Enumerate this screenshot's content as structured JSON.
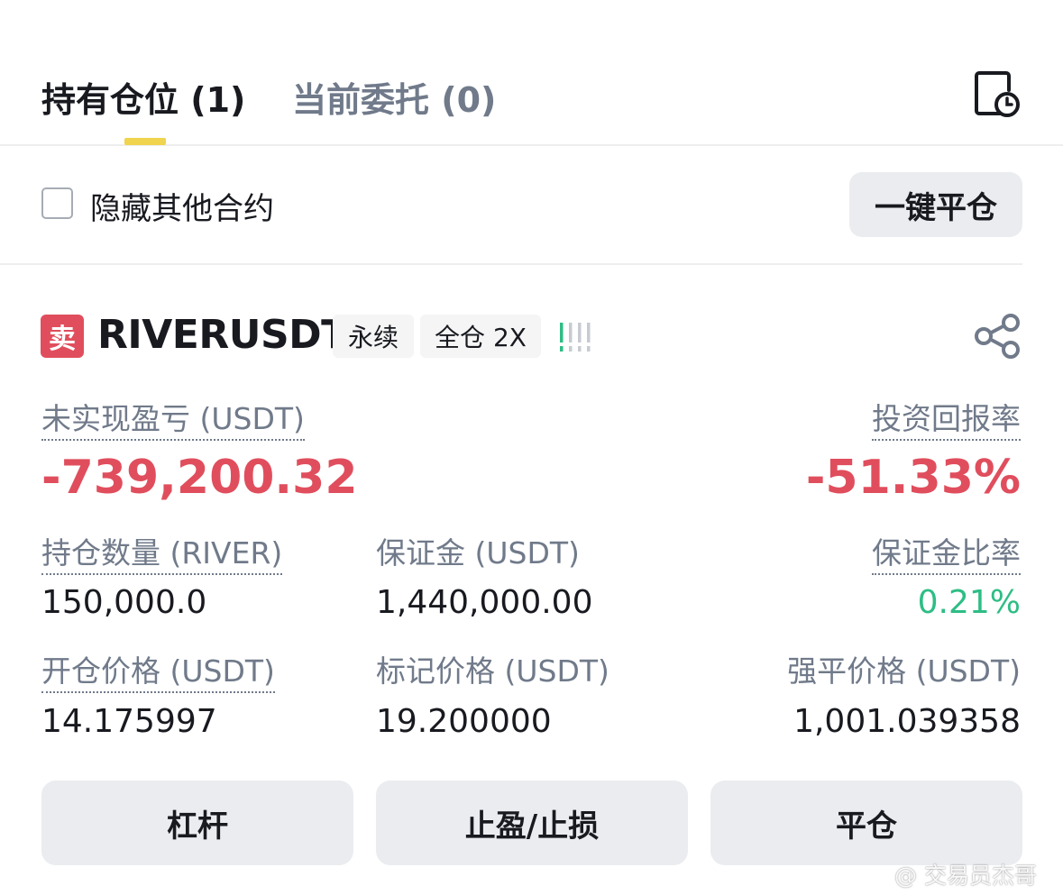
{
  "tabs": [
    {
      "label": "持有仓位 (1)"
    },
    {
      "label": "当前委托 (0)"
    }
  ],
  "filter": {
    "hide_label": "隐藏其他合约",
    "close_all_label": "一键平仓"
  },
  "position": {
    "side": "卖",
    "symbol": "RIVERUSDT",
    "contract_type": "永续",
    "margin_mode": "全仓 2X",
    "unrealized_pnl_label": "未实现盈亏 (USDT)",
    "unrealized_pnl": "-739,200.32",
    "roe_label": "投资回报率",
    "roe": "-51.33%",
    "size_label": "持仓数量 (RIVER)",
    "size": "150,000.0",
    "margin_label": "保证金 (USDT)",
    "margin": "1,440,000.00",
    "margin_ratio_label": "保证金比率",
    "margin_ratio": "0.21%",
    "entry_price_label": "开仓价格 (USDT)",
    "entry_price": "14.175997",
    "mark_price_label": "标记价格 (USDT)",
    "mark_price": "19.200000",
    "liq_price_label": "强平价格 (USDT)",
    "liq_price": "1,001.039358"
  },
  "actions": {
    "leverage_label": "杠杆",
    "tpsl_label": "止盈/止损",
    "close_label": "平仓"
  },
  "watermark": "@ 交易员杰哥",
  "colors": {
    "sell_red": "#e04e5d",
    "positive_green": "#2ebd85",
    "tab_indicator": "#f0d34f",
    "muted_gray": "#707a8a"
  },
  "icons": {
    "history": "order-history-icon",
    "share": "share-icon",
    "strength": "signal-bars-icon"
  }
}
